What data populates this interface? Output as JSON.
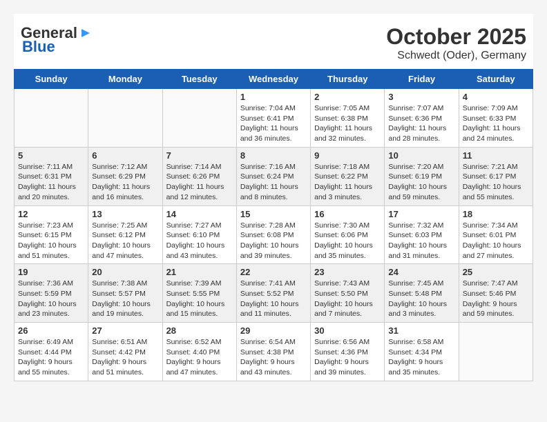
{
  "header": {
    "logo_line1": "General",
    "logo_line2": "Blue",
    "month": "October 2025",
    "location": "Schwedt (Oder), Germany"
  },
  "weekdays": [
    "Sunday",
    "Monday",
    "Tuesday",
    "Wednesday",
    "Thursday",
    "Friday",
    "Saturday"
  ],
  "weeks": [
    [
      {
        "day": "",
        "info": ""
      },
      {
        "day": "",
        "info": ""
      },
      {
        "day": "",
        "info": ""
      },
      {
        "day": "1",
        "info": "Sunrise: 7:04 AM\nSunset: 6:41 PM\nDaylight: 11 hours\nand 36 minutes."
      },
      {
        "day": "2",
        "info": "Sunrise: 7:05 AM\nSunset: 6:38 PM\nDaylight: 11 hours\nand 32 minutes."
      },
      {
        "day": "3",
        "info": "Sunrise: 7:07 AM\nSunset: 6:36 PM\nDaylight: 11 hours\nand 28 minutes."
      },
      {
        "day": "4",
        "info": "Sunrise: 7:09 AM\nSunset: 6:33 PM\nDaylight: 11 hours\nand 24 minutes."
      }
    ],
    [
      {
        "day": "5",
        "info": "Sunrise: 7:11 AM\nSunset: 6:31 PM\nDaylight: 11 hours\nand 20 minutes."
      },
      {
        "day": "6",
        "info": "Sunrise: 7:12 AM\nSunset: 6:29 PM\nDaylight: 11 hours\nand 16 minutes."
      },
      {
        "day": "7",
        "info": "Sunrise: 7:14 AM\nSunset: 6:26 PM\nDaylight: 11 hours\nand 12 minutes."
      },
      {
        "day": "8",
        "info": "Sunrise: 7:16 AM\nSunset: 6:24 PM\nDaylight: 11 hours\nand 8 minutes."
      },
      {
        "day": "9",
        "info": "Sunrise: 7:18 AM\nSunset: 6:22 PM\nDaylight: 11 hours\nand 3 minutes."
      },
      {
        "day": "10",
        "info": "Sunrise: 7:20 AM\nSunset: 6:19 PM\nDaylight: 10 hours\nand 59 minutes."
      },
      {
        "day": "11",
        "info": "Sunrise: 7:21 AM\nSunset: 6:17 PM\nDaylight: 10 hours\nand 55 minutes."
      }
    ],
    [
      {
        "day": "12",
        "info": "Sunrise: 7:23 AM\nSunset: 6:15 PM\nDaylight: 10 hours\nand 51 minutes."
      },
      {
        "day": "13",
        "info": "Sunrise: 7:25 AM\nSunset: 6:12 PM\nDaylight: 10 hours\nand 47 minutes."
      },
      {
        "day": "14",
        "info": "Sunrise: 7:27 AM\nSunset: 6:10 PM\nDaylight: 10 hours\nand 43 minutes."
      },
      {
        "day": "15",
        "info": "Sunrise: 7:28 AM\nSunset: 6:08 PM\nDaylight: 10 hours\nand 39 minutes."
      },
      {
        "day": "16",
        "info": "Sunrise: 7:30 AM\nSunset: 6:06 PM\nDaylight: 10 hours\nand 35 minutes."
      },
      {
        "day": "17",
        "info": "Sunrise: 7:32 AM\nSunset: 6:03 PM\nDaylight: 10 hours\nand 31 minutes."
      },
      {
        "day": "18",
        "info": "Sunrise: 7:34 AM\nSunset: 6:01 PM\nDaylight: 10 hours\nand 27 minutes."
      }
    ],
    [
      {
        "day": "19",
        "info": "Sunrise: 7:36 AM\nSunset: 5:59 PM\nDaylight: 10 hours\nand 23 minutes."
      },
      {
        "day": "20",
        "info": "Sunrise: 7:38 AM\nSunset: 5:57 PM\nDaylight: 10 hours\nand 19 minutes."
      },
      {
        "day": "21",
        "info": "Sunrise: 7:39 AM\nSunset: 5:55 PM\nDaylight: 10 hours\nand 15 minutes."
      },
      {
        "day": "22",
        "info": "Sunrise: 7:41 AM\nSunset: 5:52 PM\nDaylight: 10 hours\nand 11 minutes."
      },
      {
        "day": "23",
        "info": "Sunrise: 7:43 AM\nSunset: 5:50 PM\nDaylight: 10 hours\nand 7 minutes."
      },
      {
        "day": "24",
        "info": "Sunrise: 7:45 AM\nSunset: 5:48 PM\nDaylight: 10 hours\nand 3 minutes."
      },
      {
        "day": "25",
        "info": "Sunrise: 7:47 AM\nSunset: 5:46 PM\nDaylight: 9 hours\nand 59 minutes."
      }
    ],
    [
      {
        "day": "26",
        "info": "Sunrise: 6:49 AM\nSunset: 4:44 PM\nDaylight: 9 hours\nand 55 minutes."
      },
      {
        "day": "27",
        "info": "Sunrise: 6:51 AM\nSunset: 4:42 PM\nDaylight: 9 hours\nand 51 minutes."
      },
      {
        "day": "28",
        "info": "Sunrise: 6:52 AM\nSunset: 4:40 PM\nDaylight: 9 hours\nand 47 minutes."
      },
      {
        "day": "29",
        "info": "Sunrise: 6:54 AM\nSunset: 4:38 PM\nDaylight: 9 hours\nand 43 minutes."
      },
      {
        "day": "30",
        "info": "Sunrise: 6:56 AM\nSunset: 4:36 PM\nDaylight: 9 hours\nand 39 minutes."
      },
      {
        "day": "31",
        "info": "Sunrise: 6:58 AM\nSunset: 4:34 PM\nDaylight: 9 hours\nand 35 minutes."
      },
      {
        "day": "",
        "info": ""
      }
    ]
  ]
}
